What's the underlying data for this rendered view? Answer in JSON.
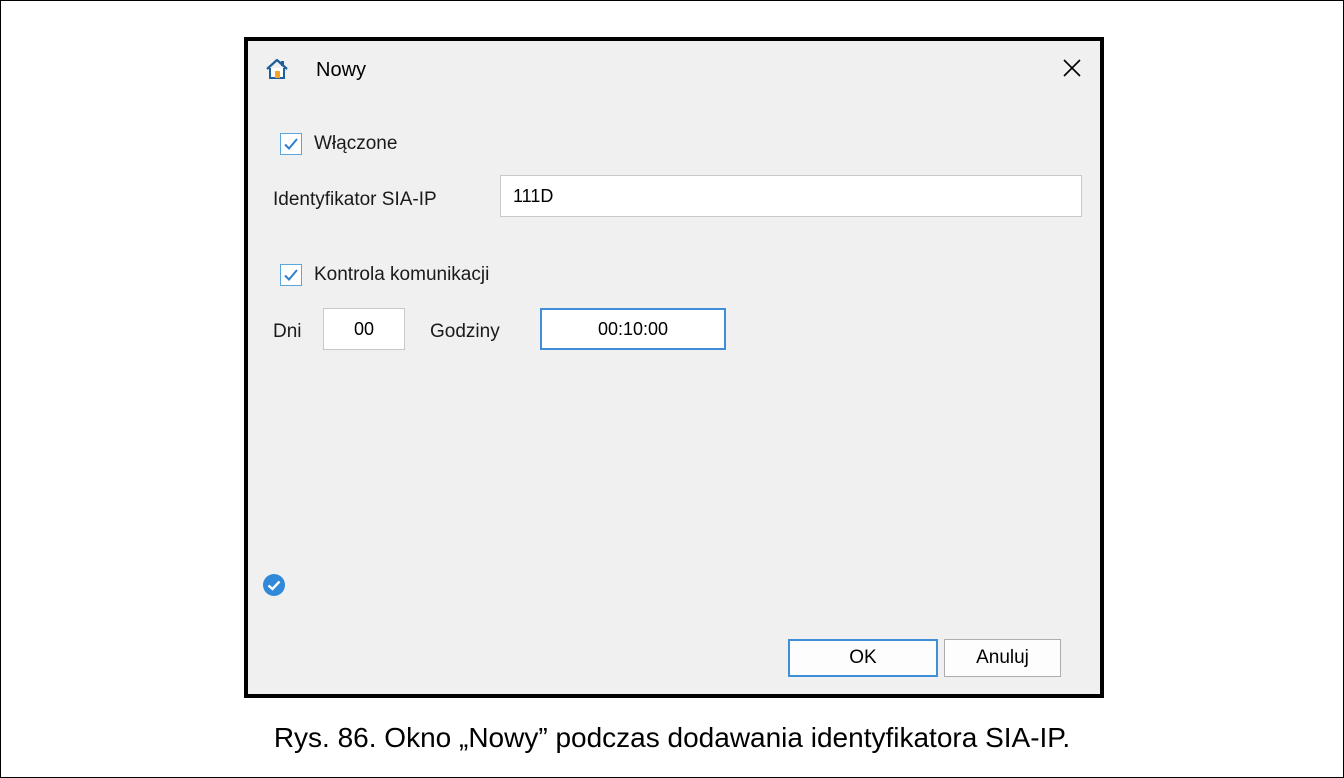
{
  "dialog": {
    "title": "Nowy",
    "title_icon": "home-icon",
    "close_icon": "close-icon",
    "enabled": {
      "label": "Włączone",
      "checked": true
    },
    "identifier": {
      "label": "Identyfikator SIA-IP",
      "value": "111D"
    },
    "comm_control": {
      "label": "Kontrola komunikacji",
      "checked": true
    },
    "days": {
      "label": "Dni",
      "value": "00"
    },
    "hours": {
      "label": "Godziny",
      "value": "00:10:00"
    },
    "status_icon": "check-circle-icon",
    "ok_label": "OK",
    "cancel_label": "Anuluj"
  },
  "caption": "Rys. 86. Okno „Nowy” podczas dodawania identyfikatora SIA-IP.",
  "colors": {
    "accent": "#3f8ed8",
    "dialog_bg": "#f0f0f0"
  }
}
